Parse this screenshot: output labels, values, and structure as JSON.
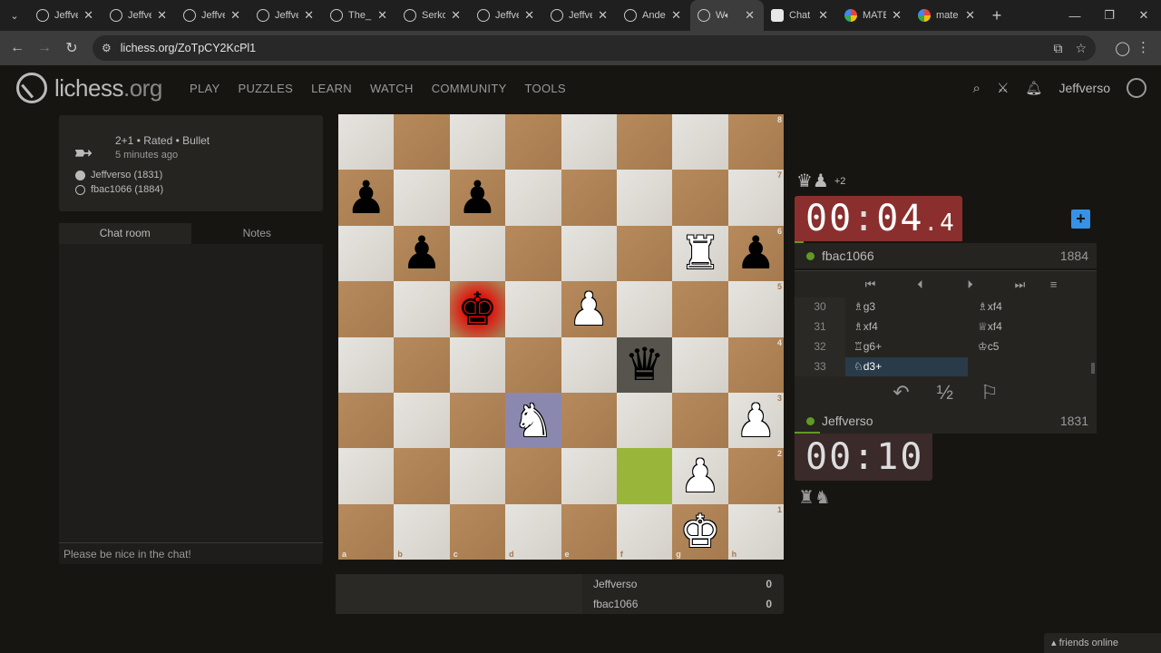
{
  "browser": {
    "tabs": [
      {
        "title": "Jeffverso",
        "icon": "lichess"
      },
      {
        "title": "Jeffverso",
        "icon": "lichess"
      },
      {
        "title": "Jeffverso",
        "icon": "lichess"
      },
      {
        "title": "Jeffverso",
        "icon": "lichess"
      },
      {
        "title": "The_",
        "icon": "lichess"
      },
      {
        "title": "Serko",
        "icon": "lichess"
      },
      {
        "title": "Jeffverso",
        "icon": "lichess"
      },
      {
        "title": "Jeffverso",
        "icon": "lichess"
      },
      {
        "title": "Ander",
        "icon": "lichess"
      },
      {
        "title": "W",
        "icon": "lichess",
        "active": true
      },
      {
        "title": "Chat",
        "icon": "chat"
      },
      {
        "title": "MATE",
        "icon": "google"
      },
      {
        "title": "mate",
        "icon": "google"
      }
    ],
    "url": "lichess.org/ZoTpCY2KcPl1"
  },
  "header": {
    "logo_main": "lichess",
    "logo_tld": ".org",
    "nav": [
      "PLAY",
      "PUZZLES",
      "LEARN",
      "WATCH",
      "COMMUNITY",
      "TOOLS"
    ],
    "username": "Jeffverso"
  },
  "game_info": {
    "setup": "2+1 • Rated • Bullet",
    "time_ago": "5 minutes ago",
    "white_player": "Jeffverso (1831)",
    "black_player": "fbac1066 (1884)"
  },
  "chat": {
    "tab_chat": "Chat room",
    "tab_notes": "Notes",
    "placeholder": "Please be nice in the chat!"
  },
  "board": {
    "ranks": [
      "8",
      "7",
      "6",
      "5",
      "4",
      "3",
      "2",
      "1"
    ],
    "files": [
      "a",
      "b",
      "c",
      "d",
      "e",
      "f",
      "g",
      "h"
    ]
  },
  "opponent": {
    "material": "♛♟",
    "material_diff": "+2",
    "clock_main": "00",
    "clock_sec": "04",
    "clock_tenths": "4",
    "name": "fbac1066",
    "rating": "1884"
  },
  "controls": {
    "first": "⏮",
    "prev": "⏴",
    "next": "⏵",
    "last": "⏭",
    "menu": "≡"
  },
  "moves": [
    {
      "num": "30",
      "white": "♗g3",
      "black": "♗xf4"
    },
    {
      "num": "31",
      "white": "♗xf4",
      "black": "♕xf4"
    },
    {
      "num": "32",
      "white": "♖g6+",
      "black": "♔c5"
    },
    {
      "num": "33",
      "white": "♘d3+",
      "black": ""
    }
  ],
  "actions": {
    "takeback": "↶",
    "draw": "½",
    "resign": "⚐"
  },
  "me": {
    "name": "Jeffverso",
    "rating": "1831",
    "clock_min": "00",
    "clock_sec": "10",
    "material": "♜♞"
  },
  "crosstable": [
    {
      "name": "Jeffverso",
      "score": "0"
    },
    {
      "name": "fbac1066",
      "score": "0"
    }
  ],
  "friends": "friends online"
}
